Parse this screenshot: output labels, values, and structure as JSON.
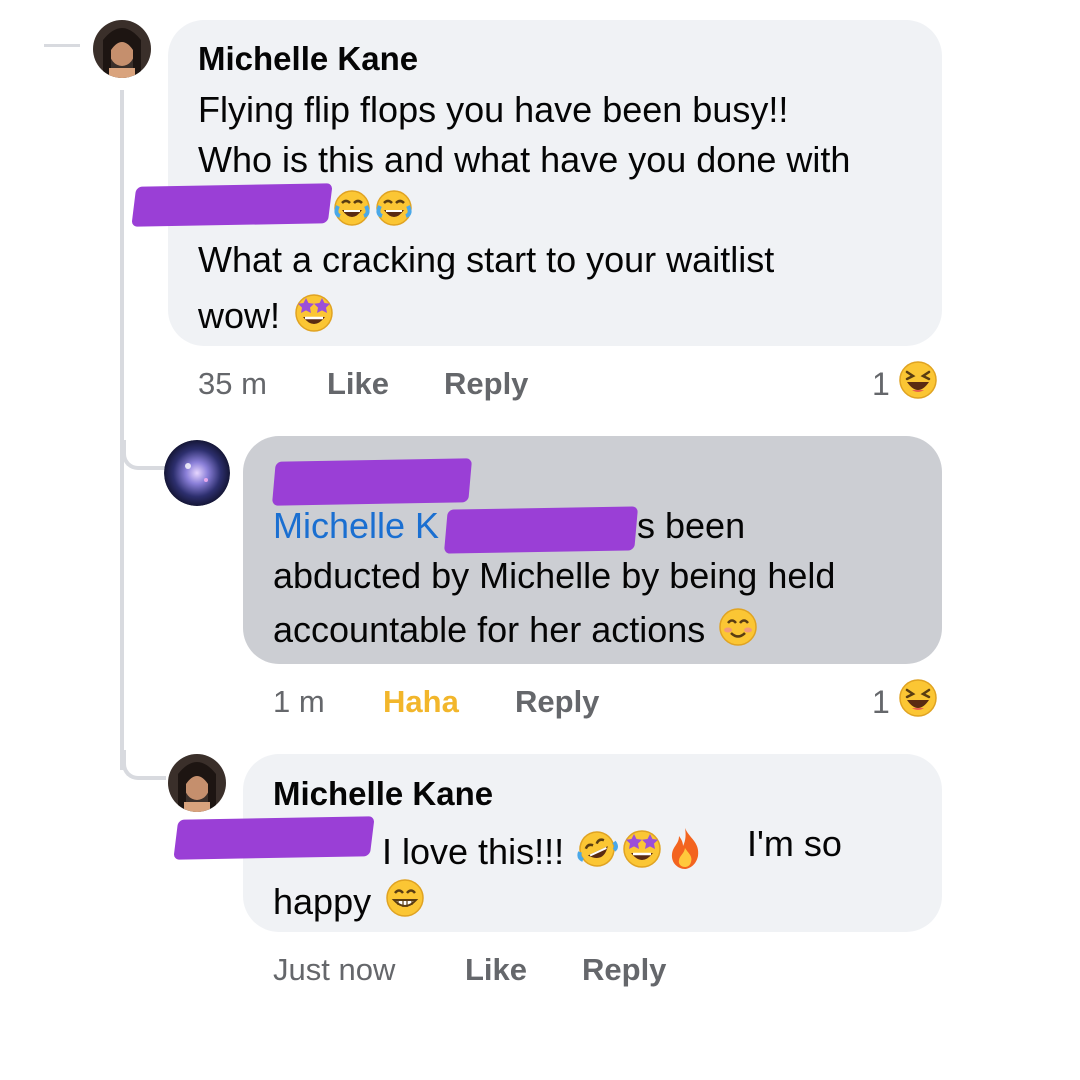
{
  "comments": [
    {
      "author": "Michelle Kane",
      "lines": [
        "Flying flip flops you have been busy!!",
        "Who is this and what have you done with",
        "What a cracking start to your waitlist",
        "wow!"
      ],
      "time": "35 m",
      "like": "Like",
      "reply": "Reply",
      "reaction_count": "1"
    },
    {
      "mention": "Michelle K",
      "lines": [
        "s been",
        "abducted by Michelle by being held",
        "accountable for her actions"
      ],
      "time": "1 m",
      "reaction_label": "Haha",
      "reply": "Reply",
      "reaction_count": "1"
    },
    {
      "author": "Michelle Kane",
      "lines": [
        "I love this!!!",
        "I'm so",
        "happy"
      ],
      "time": "Just now",
      "like": "Like",
      "reply": "Reply"
    }
  ],
  "colors": {
    "bubble": "#f0f2f5",
    "bubble_selected": "#ccced3",
    "mention": "#1a6fd1",
    "haha_active": "#f2b62b",
    "redaction": "#9a3fd6"
  },
  "icons": [
    "joy-emoji-icon",
    "star-struck-emoji-icon",
    "laughing-reaction-icon",
    "smiling-emoji-icon",
    "rofl-emoji-icon",
    "fire-emoji-icon",
    "grinning-emoji-icon"
  ]
}
